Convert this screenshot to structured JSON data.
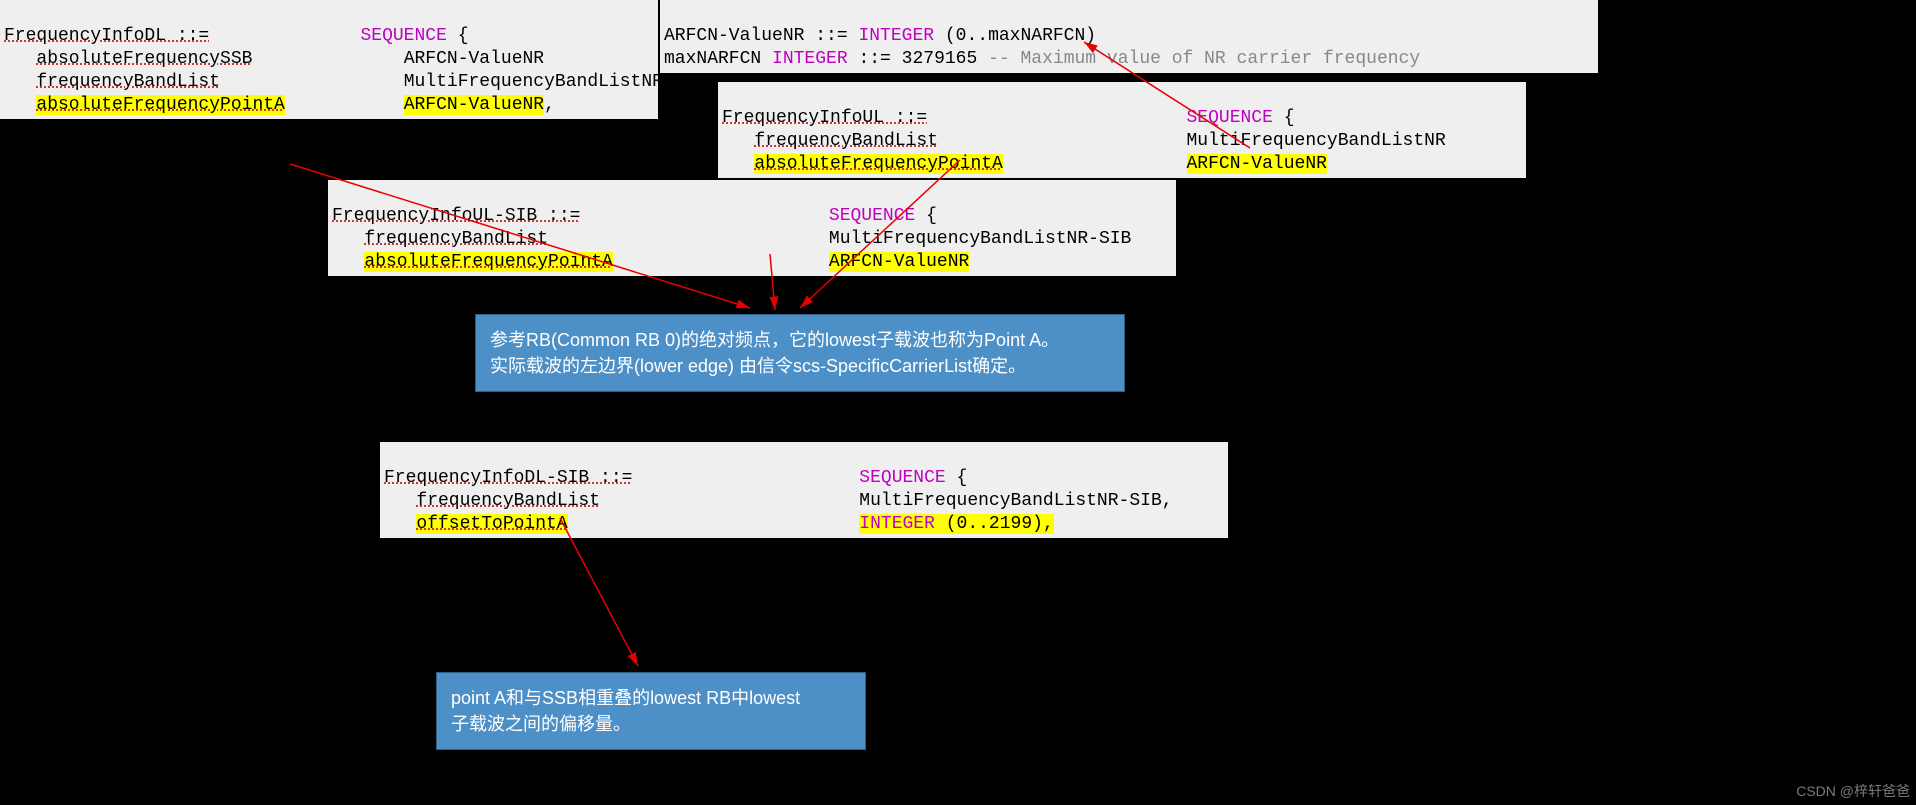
{
  "top": {
    "l1a": "ARFCN-ValueNR ::= ",
    "l1b": "INTEGER",
    "l1c": " (0..maxNARFCN)",
    "l2a": "maxNARFCN ",
    "l2b": "INTEGER",
    "l2c": " ::= 3279165 ",
    "l2d": "-- Maximum value of NR carrier frequency"
  },
  "dl": {
    "h1": "FrequencyInfoDL ::=",
    "h2": "SEQUENCE",
    "h3": " {",
    "r1a": "absoluteFrequencySSB",
    "r1b": "ARFCN-ValueNR",
    "r2a": "frequencyBandList",
    "r2b": "MultiFrequencyBandListNR,",
    "r3a": "absoluteFrequencyPointA",
    "r3b": "ARFCN-ValueNR",
    "r3c": ","
  },
  "ul": {
    "h1": "FrequencyInfoUL ::=",
    "h2": "SEQUENCE",
    "h3": " {",
    "r1a": "frequencyBandList",
    "r1b": "MultiFrequencyBandListNR",
    "r2a": "absoluteFrequencyPointA",
    "r2b": "ARFCN-ValueNR"
  },
  "ulsib": {
    "h1": "FrequencyInfoUL-SIB ::=",
    "h2": "SEQUENCE",
    "h3": " {",
    "r1a": "frequencyBandList",
    "r1b": "MultiFrequencyBandListNR-SIB",
    "r2a": "absoluteFrequencyPointA",
    "r2b": "ARFCN-ValueNR"
  },
  "dlsib": {
    "h1": "FrequencyInfoDL-SIB ::=",
    "h2": "SEQUENCE",
    "h3": " {",
    "r1a": "frequencyBandList",
    "r1b": "MultiFrequencyBandListNR-SIB,",
    "r2a": "offsetToPointA",
    "r2b": "INTEGER",
    "r2c": " (0..2199),"
  },
  "note1": {
    "l1": "参考RB(Common RB 0)的绝对频点，它的lowest子载波也称为Point A。",
    "l2": "实际载波的左边界(lower  edge) 由信令scs-SpecificCarrierList确定。"
  },
  "note2": {
    "l1": "point A和与SSB相重叠的lowest RB中lowest",
    "l2": "子载波之间的偏移量。"
  },
  "watermark": "CSDN @梓轩爸爸"
}
